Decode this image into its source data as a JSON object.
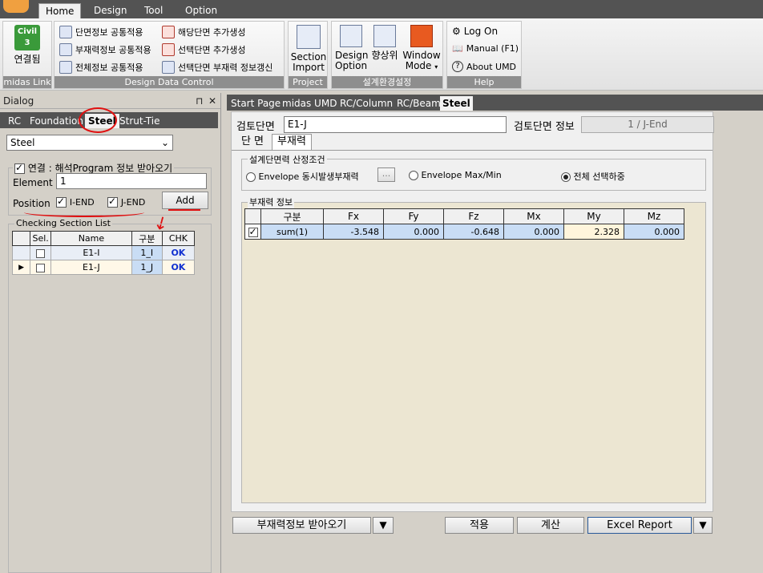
{
  "ribbon": {
    "tabs": [
      "Home",
      "Design",
      "Tool",
      "Option"
    ],
    "midas_link": {
      "icon_text": "Civil",
      "label": "연결됨",
      "group": "midas Link"
    },
    "design_data_control": {
      "group": "Design Data Control",
      "items": [
        "단면정보 공통적용",
        "부재력정보 공통적용",
        "전체정보 공통적용",
        "해당단면 추가생성",
        "선택단면 추가생성",
        "선택단면 부재력 정보갱신"
      ]
    },
    "project": {
      "group": "Project",
      "section_import": [
        "Section",
        "Import"
      ]
    },
    "settings": {
      "group": "설계환경설정",
      "design_option": [
        "Design",
        "Option"
      ],
      "improve": "향상위",
      "window_mode": [
        "Window",
        "Mode"
      ]
    },
    "help": {
      "group": "Help",
      "items": [
        "Log On",
        "Manual (F1)",
        "About UMD"
      ]
    }
  },
  "dialog": {
    "title": "Dialog",
    "pin": "⊓",
    "close": "✕",
    "tabs": [
      "RC",
      "Foundation",
      "Steel",
      "Strut-Tie"
    ],
    "type_select": "Steel",
    "connect_label": "연결 : 해석Program 정보 받아오기",
    "element_label": "Element",
    "element_value": "1",
    "position_label": "Position",
    "i_end": "I-END",
    "j_end": "J-END",
    "add_label": "Add",
    "list_title": "Checking Section List",
    "list_headers": [
      "Sel.",
      "Name",
      "구분",
      "CHK"
    ],
    "list_rows": [
      {
        "name": "E1-I",
        "type": "1_I",
        "chk": "OK"
      },
      {
        "name": "E1-J",
        "type": "1_J",
        "chk": "OK"
      }
    ]
  },
  "main": {
    "doc_tabs": [
      "Start Page",
      "midas UMD",
      "RC/Column",
      "RC/Beam",
      "Steel"
    ],
    "section_label": "검토단면",
    "section_value": "E1-J",
    "section_info_label": "검토단면 정보",
    "section_info_value": "1  /  J-End",
    "sub_tabs": [
      "단 면",
      "부재력"
    ],
    "design_cond_title": "설계단면력 산정조건",
    "radio1": "Envelope 동시발생부재력",
    "dots": "...",
    "radio2": "Envelope Max/Min",
    "radio3": "전체 선택하중",
    "force_title": "부재력 정보",
    "force_headers": [
      "구분",
      "Fx",
      "Fy",
      "Fz",
      "Mx",
      "My",
      "Mz"
    ],
    "force_row": {
      "name": "sum(1)",
      "fx": "-3.548",
      "fy": "0.000",
      "fz": "-0.648",
      "mx": "0.000",
      "my": "2.328",
      "mz": "0.000"
    },
    "btn_get_forces": "부재력정보 받아오기",
    "btn_apply": "적용",
    "btn_calc": "계산",
    "btn_excel": "Excel Report"
  },
  "colors": {
    "accent_red": "#e01010",
    "ok_blue": "#1030d0",
    "selected_row": "#c9ddf5",
    "highlight_cell": "#fff5dc"
  }
}
